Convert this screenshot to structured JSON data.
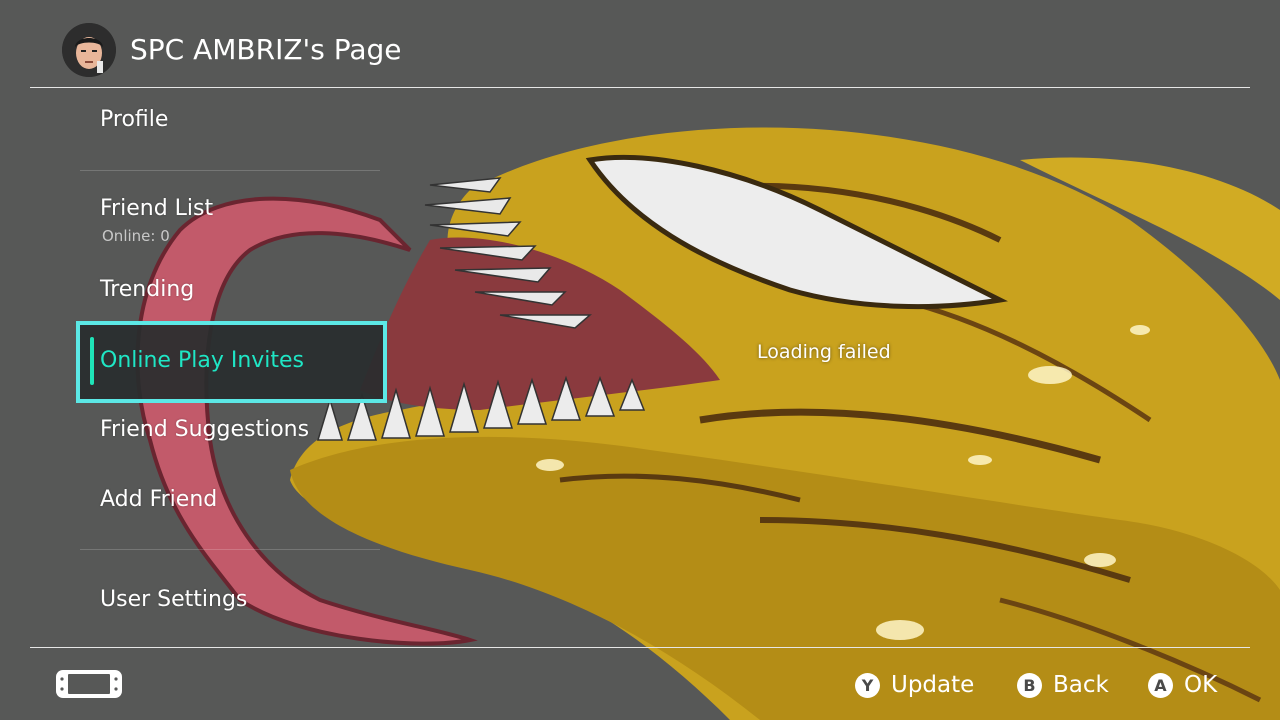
{
  "header": {
    "title": "SPC AMBRIZ's Page",
    "avatar_icon": "mii-avatar-icon"
  },
  "menu": {
    "items": [
      {
        "label": "Profile"
      },
      {
        "label": "Friend List",
        "sub": "Online: 0"
      },
      {
        "label": "Trending"
      },
      {
        "label": "Online Play Invites",
        "selected": true
      },
      {
        "label": "Friend Suggestions"
      },
      {
        "label": "Add Friend"
      },
      {
        "label": "User Settings"
      }
    ]
  },
  "main": {
    "status": "Loading failed"
  },
  "footer": {
    "console_icon": "switch-console-icon",
    "buttons": [
      {
        "glyph": "Y",
        "label": "Update"
      },
      {
        "glyph": "B",
        "label": "Back"
      },
      {
        "glyph": "A",
        "label": "OK"
      }
    ]
  },
  "colors": {
    "background": "#575857",
    "selection_border": "#5ce8e6",
    "selection_text": "#1fe6c5",
    "artwork_yellow": "#c9a21e",
    "artwork_tongue": "#c25a6a"
  }
}
